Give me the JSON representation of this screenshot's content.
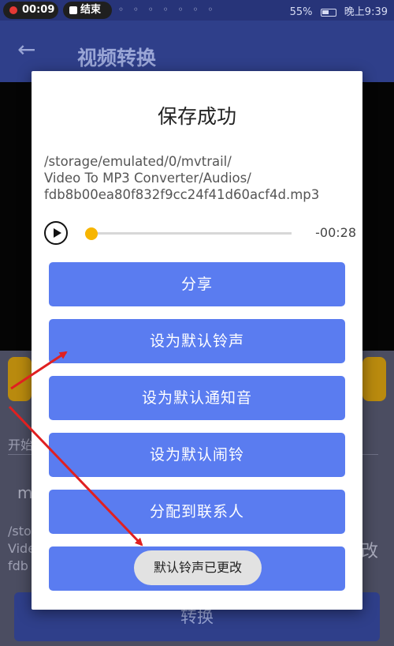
{
  "status_bar": {
    "recording_time": "00:09",
    "end_label": "结束",
    "battery": "55%",
    "time": "晚上9:39"
  },
  "app_bar": {
    "title": "视频转换"
  },
  "background": {
    "label_start": "开始",
    "field_value": "m",
    "path_partial": "/sto\nVide\nfdb",
    "side_char": "改",
    "convert_button": "转换"
  },
  "dialog": {
    "title": "保存成功",
    "file_path": "/storage/emulated/0/mvtrail/\nVideo To MP3 Converter/Audios/\nfdb8b00ea80f832f9cc24f41d60acf4d.mp3",
    "player": {
      "time_remaining": "-00:28",
      "progress": 0.0
    },
    "buttons": {
      "share": "分享",
      "set_ringtone": "设为默认铃声",
      "set_notification": "设为默认通知音",
      "set_alarm": "设为默认闹铃",
      "assign_contact": "分配到联系人",
      "last": ""
    }
  },
  "toast": {
    "message": "默认铃声已更改"
  },
  "colors": {
    "button": "#5a7cf0",
    "accent": "#f7b500",
    "annotation_arrow": "#e02020"
  }
}
